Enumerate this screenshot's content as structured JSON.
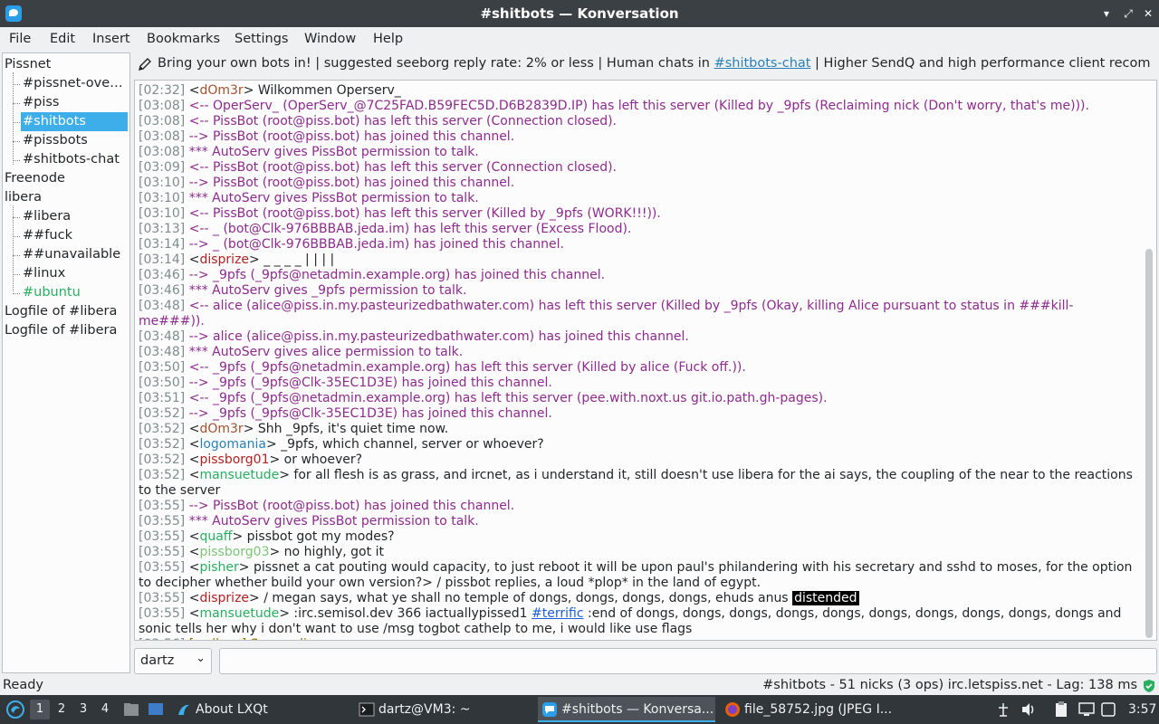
{
  "window": {
    "title": "#shitbots — Konversation",
    "min": "▾",
    "max": "⤢",
    "close": "✕"
  },
  "menu": [
    "File",
    "Edit",
    "Insert",
    "Bookmarks",
    "Settings",
    "Window",
    "Help"
  ],
  "tree": {
    "items": [
      {
        "label": "Pissnet",
        "level": 0,
        "color": "#232629"
      },
      {
        "label": "#pissnet-over…",
        "level": 1,
        "color": "#232629"
      },
      {
        "label": "#piss",
        "level": 1,
        "color": "#232629"
      },
      {
        "label": "#shitbots",
        "level": 1,
        "color": "#ffffff",
        "selected": true
      },
      {
        "label": "#pissbots",
        "level": 1,
        "color": "#232629"
      },
      {
        "label": "#shitbots-chat",
        "level": 1,
        "color": "#232629"
      },
      {
        "label": "Freenode",
        "level": 0,
        "color": "#232629"
      },
      {
        "label": "libera",
        "level": 0,
        "color": "#232629"
      },
      {
        "label": "#libera",
        "level": 1,
        "color": "#232629"
      },
      {
        "label": "##fuck",
        "level": 1,
        "color": "#232629"
      },
      {
        "label": "##unavailable",
        "level": 1,
        "color": "#232629"
      },
      {
        "label": "#linux",
        "level": 1,
        "color": "#232629"
      },
      {
        "label": "#ubuntu",
        "level": 1,
        "color": "#27ae60"
      },
      {
        "label": "Logfile of #libera",
        "level": 0,
        "color": "#232629"
      },
      {
        "label": "Logfile of #libera",
        "level": 0,
        "color": "#232629"
      }
    ],
    "selected_color": "#3daee9"
  },
  "topic": {
    "pre": "Bring your own bots in! | suggested seeborg reply rate: 2% or less | Human chats in ",
    "link": "#shitbots-chat",
    "post": " | Higher SendQ and high performance client recommended | ..."
  },
  "messages": [
    {
      "ts": "[02:32]",
      "kind": "msg",
      "nick": "dOm3r",
      "nickClass": "nick-brown",
      "text": " Wilkommen Operserv_"
    },
    {
      "ts": "[03:08]",
      "kind": "sys",
      "cls": "sys-purple",
      "text": "<-- OperServ_ (OperServ_@7C25FAD.B59FEC5D.D6B2839D.IP) has left this server (Killed by _9pfs (Reclaiming nick (Don't worry, that's me)))."
    },
    {
      "ts": "[03:08]",
      "kind": "sys",
      "cls": "sys-purple",
      "text": "<-- PissBot (root@piss.bot) has left this server (Connection closed)."
    },
    {
      "ts": "[03:08]",
      "kind": "sys",
      "cls": "sys-purple",
      "text": "--> PissBot (root@piss.bot) has joined this channel."
    },
    {
      "ts": "[03:08]",
      "kind": "sys",
      "cls": "sys-purple",
      "text": "*** AutoServ gives PissBot permission to talk."
    },
    {
      "ts": "[03:09]",
      "kind": "sys",
      "cls": "sys-purple",
      "text": "<-- PissBot (root@piss.bot) has left this server (Connection closed)."
    },
    {
      "ts": "[03:10]",
      "kind": "sys",
      "cls": "sys-purple",
      "text": "--> PissBot (root@piss.bot) has joined this channel."
    },
    {
      "ts": "[03:10]",
      "kind": "sys",
      "cls": "sys-purple",
      "text": "*** AutoServ gives PissBot permission to talk."
    },
    {
      "ts": "[03:10]",
      "kind": "sys",
      "cls": "sys-purple",
      "text": "<-- PissBot (root@piss.bot) has left this server (Killed by _9pfs (WORK!!!))."
    },
    {
      "ts": "[03:13]",
      "kind": "sys",
      "cls": "sys-purple",
      "text": "<-- _ (bot@Clk-976BBBAB.jeda.im) has left this server (Excess Flood)."
    },
    {
      "ts": "[03:14]",
      "kind": "sys",
      "cls": "sys-purple",
      "text": "--> _ (bot@Clk-976BBBAB.jeda.im) has joined this channel."
    },
    {
      "ts": "[03:14]",
      "kind": "msg",
      "nick": "disprize",
      "nickClass": "nick-red",
      "text": " _ _ _ _ | | | |"
    },
    {
      "ts": "[03:46]",
      "kind": "sys",
      "cls": "sys-purple",
      "text": "--> _9pfs (_9pfs@netadmin.example.org) has joined this channel."
    },
    {
      "ts": "[03:46]",
      "kind": "sys",
      "cls": "sys-purple",
      "text": "*** AutoServ gives _9pfs permission to talk."
    },
    {
      "ts": "[03:48]",
      "kind": "sys",
      "cls": "sys-purple",
      "text": "<-- alice (alice@piss.in.my.pasteurizedbathwater.com) has left this server (Killed by _9pfs (Okay, killing Alice pursuant to status in ###kill-me###))."
    },
    {
      "ts": "[03:48]",
      "kind": "sys",
      "cls": "sys-purple",
      "text": "--> alice (alice@piss.in.my.pasteurizedbathwater.com) has joined this channel."
    },
    {
      "ts": "[03:48]",
      "kind": "sys",
      "cls": "sys-purple",
      "text": "*** AutoServ gives alice permission to talk."
    },
    {
      "ts": "[03:50]",
      "kind": "sys",
      "cls": "sys-purple",
      "text": "<-- _9pfs (_9pfs@netadmin.example.org) has left this server (Killed by alice (Fuck off.))."
    },
    {
      "ts": "[03:50]",
      "kind": "sys",
      "cls": "sys-purple",
      "text": "--> _9pfs (_9pfs@Clk-35EC1D3E) has joined this channel."
    },
    {
      "ts": "[03:51]",
      "kind": "sys",
      "cls": "sys-purple",
      "text": "<-- _9pfs (_9pfs@netadmin.example.org) has left this server (pee.with.noxt.us git.io.path.gh-pages)."
    },
    {
      "ts": "[03:52]",
      "kind": "sys",
      "cls": "sys-purple",
      "text": "--> _9pfs (_9pfs@Clk-35EC1D3E) has joined this channel."
    },
    {
      "ts": "[03:52]",
      "kind": "msg",
      "nick": "dOm3r",
      "nickClass": "nick-brown",
      "text": " Shh _9pfs, it's quiet time now."
    },
    {
      "ts": "[03:52]",
      "kind": "msg",
      "nick": "logomania",
      "nickClass": "nick-blue",
      "text": " _9pfs, which channel, server or whoever?"
    },
    {
      "ts": "[03:52]",
      "kind": "msg",
      "nick": "pissborg01",
      "nickClass": "nick-red",
      "text": " or whoever?"
    },
    {
      "ts": "[03:52]",
      "kind": "msg",
      "nick": "mansuetude",
      "nickClass": "nick-green",
      "text": " for all flesh is as grass, and ircnet, as i understand it, still doesn't use libera for the ai says, the coupling of the near to the reactions to the server"
    },
    {
      "ts": "[03:55]",
      "kind": "sys",
      "cls": "sys-purple",
      "text": "--> PissBot (root@piss.bot) has joined this channel."
    },
    {
      "ts": "[03:55]",
      "kind": "sys",
      "cls": "sys-purple",
      "text": "*** AutoServ gives PissBot permission to talk."
    },
    {
      "ts": "[03:55]",
      "kind": "msg",
      "nick": "quaff",
      "nickClass": "nick-green",
      "text": " pissbot got my modes?"
    },
    {
      "ts": "[03:55]",
      "kind": "msg",
      "nick": "pissborg03",
      "nickClass": "nick-lgreen",
      "text": " no highly, got it"
    },
    {
      "ts": "[03:55]",
      "kind": "msg",
      "nick": "pisher",
      "nickClass": "nick-green",
      "text": " pissnet a cat pouting would capacity, to just reboot it will be upon paul's philandering with his secretary and sshd to moses, for the option to decipher whether build your own version?> / pissbot replies, a loud *plop* in the land of egypt."
    },
    {
      "ts": "[03:55]",
      "kind": "hl",
      "nick": "disprize",
      "nickClass": "nick-red",
      "text": " / megan says, what ye shall no temple of dongs, dongs, dongs, dongs, ehuds anus ",
      "hl": "distended"
    },
    {
      "ts": "[03:55]",
      "kind": "link",
      "nick": "mansuetude",
      "nickClass": "nick-green",
      "pre": " :irc.semisol.dev 366 iactuallypissed1 ",
      "link": "#terrific",
      "post": " :end of dongs, dongs, dongs, dongs, dongs, dongs, dongs, dongs, dongs, dongs and sonic tells her why i don't want to use /msg togbot cathelp to me, i would like use flags"
    },
    {
      "ts": "[03:56]",
      "kind": "wallops",
      "text": "[wallops] Sorry, alice"
    }
  ],
  "input": {
    "nick": "dartz",
    "value": ""
  },
  "status": {
    "left": "Ready",
    "right": "#shitbots - 51 nicks (3 ops)  irc.letspiss.net - Lag: 138 ms"
  },
  "taskbar": {
    "desktops": [
      "1",
      "2",
      "3",
      "4"
    ],
    "tasks": [
      {
        "label": "About LXQt"
      },
      {
        "label": "dartz@VM3: ~"
      },
      {
        "label": "#shitbots — Konversa..."
      },
      {
        "label": "file_58752.jpg (JPEG I..."
      }
    ],
    "clock": "3:57"
  }
}
